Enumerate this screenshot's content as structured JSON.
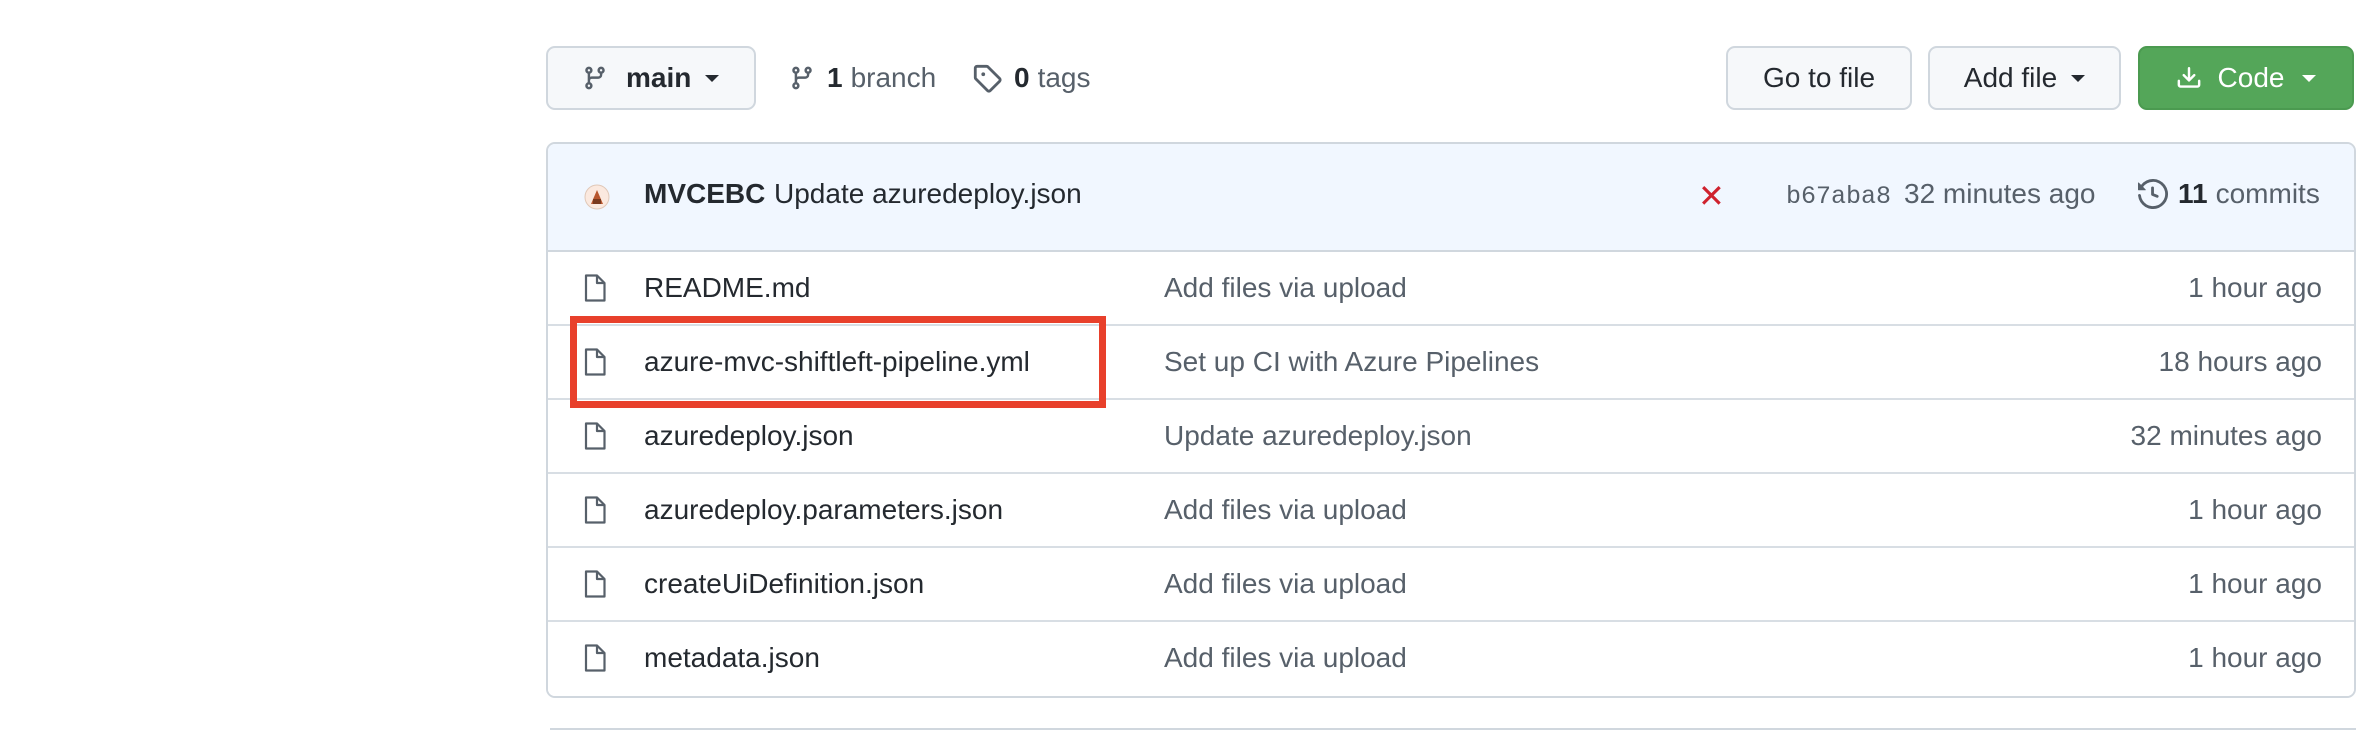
{
  "toolbar": {
    "branch_selector": {
      "label": "main",
      "icon": "git-branch-icon"
    },
    "branches": {
      "count": "1",
      "label": "branch",
      "icon": "git-branch-icon"
    },
    "tags": {
      "count": "0",
      "label": "tags",
      "icon": "tag-icon"
    },
    "go_to_file_label": "Go to file",
    "add_file_label": "Add file",
    "code_label": "Code",
    "code_icon": "download-icon"
  },
  "latest_commit": {
    "author": "MVCEBC",
    "message": "Update azuredeploy.json",
    "status": "✕",
    "status_color": "#cf222e",
    "sha": "b67aba8",
    "time": "32 minutes ago",
    "commits_count": "11",
    "commits_label": "commits",
    "history_icon": "history-icon"
  },
  "files": [
    {
      "name": "README.md",
      "message": "Add files via upload",
      "age": "1 hour ago"
    },
    {
      "name": "azure-mvc-shiftleft-pipeline.yml",
      "message": "Set up CI with Azure Pipelines",
      "age": "18 hours ago"
    },
    {
      "name": "azuredeploy.json",
      "message": "Update azuredeploy.json",
      "age": "32 minutes ago"
    },
    {
      "name": "azuredeploy.parameters.json",
      "message": "Add files via upload",
      "age": "1 hour ago"
    },
    {
      "name": "createUiDefinition.json",
      "message": "Add files via upload",
      "age": "1 hour ago"
    },
    {
      "name": "metadata.json",
      "message": "Add files via upload",
      "age": "1 hour ago"
    }
  ],
  "colors": {
    "code_button": "#54a659",
    "commit_bar_bg": "#f1f7ff",
    "highlight_box": "#e8402b"
  }
}
